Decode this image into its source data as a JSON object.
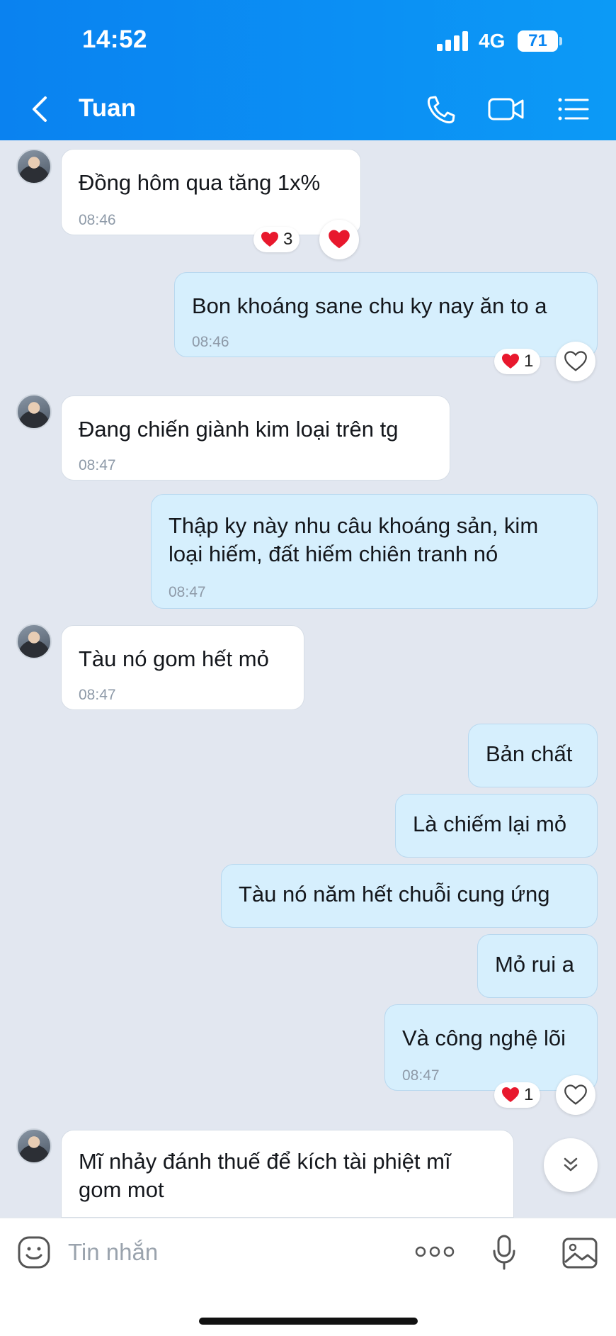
{
  "status": {
    "time": "14:52",
    "network": "4G",
    "battery": "71"
  },
  "header": {
    "contact_name": "Tuan"
  },
  "messages": [
    {
      "text": "Đồng hôm qua tăng 1x%",
      "time": "08:46",
      "reaction_count": "3"
    },
    {
      "text": "Bon khoáng sane chu ky nay ăn to a",
      "time": "08:46",
      "reaction_count": "1"
    },
    {
      "text": "Đang chiến giành kim loại trên tg",
      "time": "08:47"
    },
    {
      "line1": "Thập ky này nhu câu khoáng sản, kim",
      "line2": "loại hiếm, đất hiếm chiên tranh nó",
      "time": "08:47"
    },
    {
      "text": "Tàu nó gom hết mỏ",
      "time": "08:47"
    },
    {
      "text": "Bản chất"
    },
    {
      "text": "Là chiếm lại mỏ"
    },
    {
      "text": "Tàu nó năm hết chuỗi cung ứng"
    },
    {
      "text": "Mỏ rui a"
    },
    {
      "text": "Và công nghệ lõi",
      "time": "08:47",
      "reaction_count": "1"
    },
    {
      "line1": "Mĩ nhảy đánh thuế để kích tài phiệt mĩ",
      "line2": "gom mot"
    }
  ],
  "input": {
    "placeholder": "Tin nhắn",
    "value": ""
  },
  "colors": {
    "header": "#0b8cf3",
    "outgoing_bubble": "#d6effd",
    "incoming_bubble": "#ffffff",
    "background": "#e2e7f0",
    "heart": "#e8182d"
  }
}
